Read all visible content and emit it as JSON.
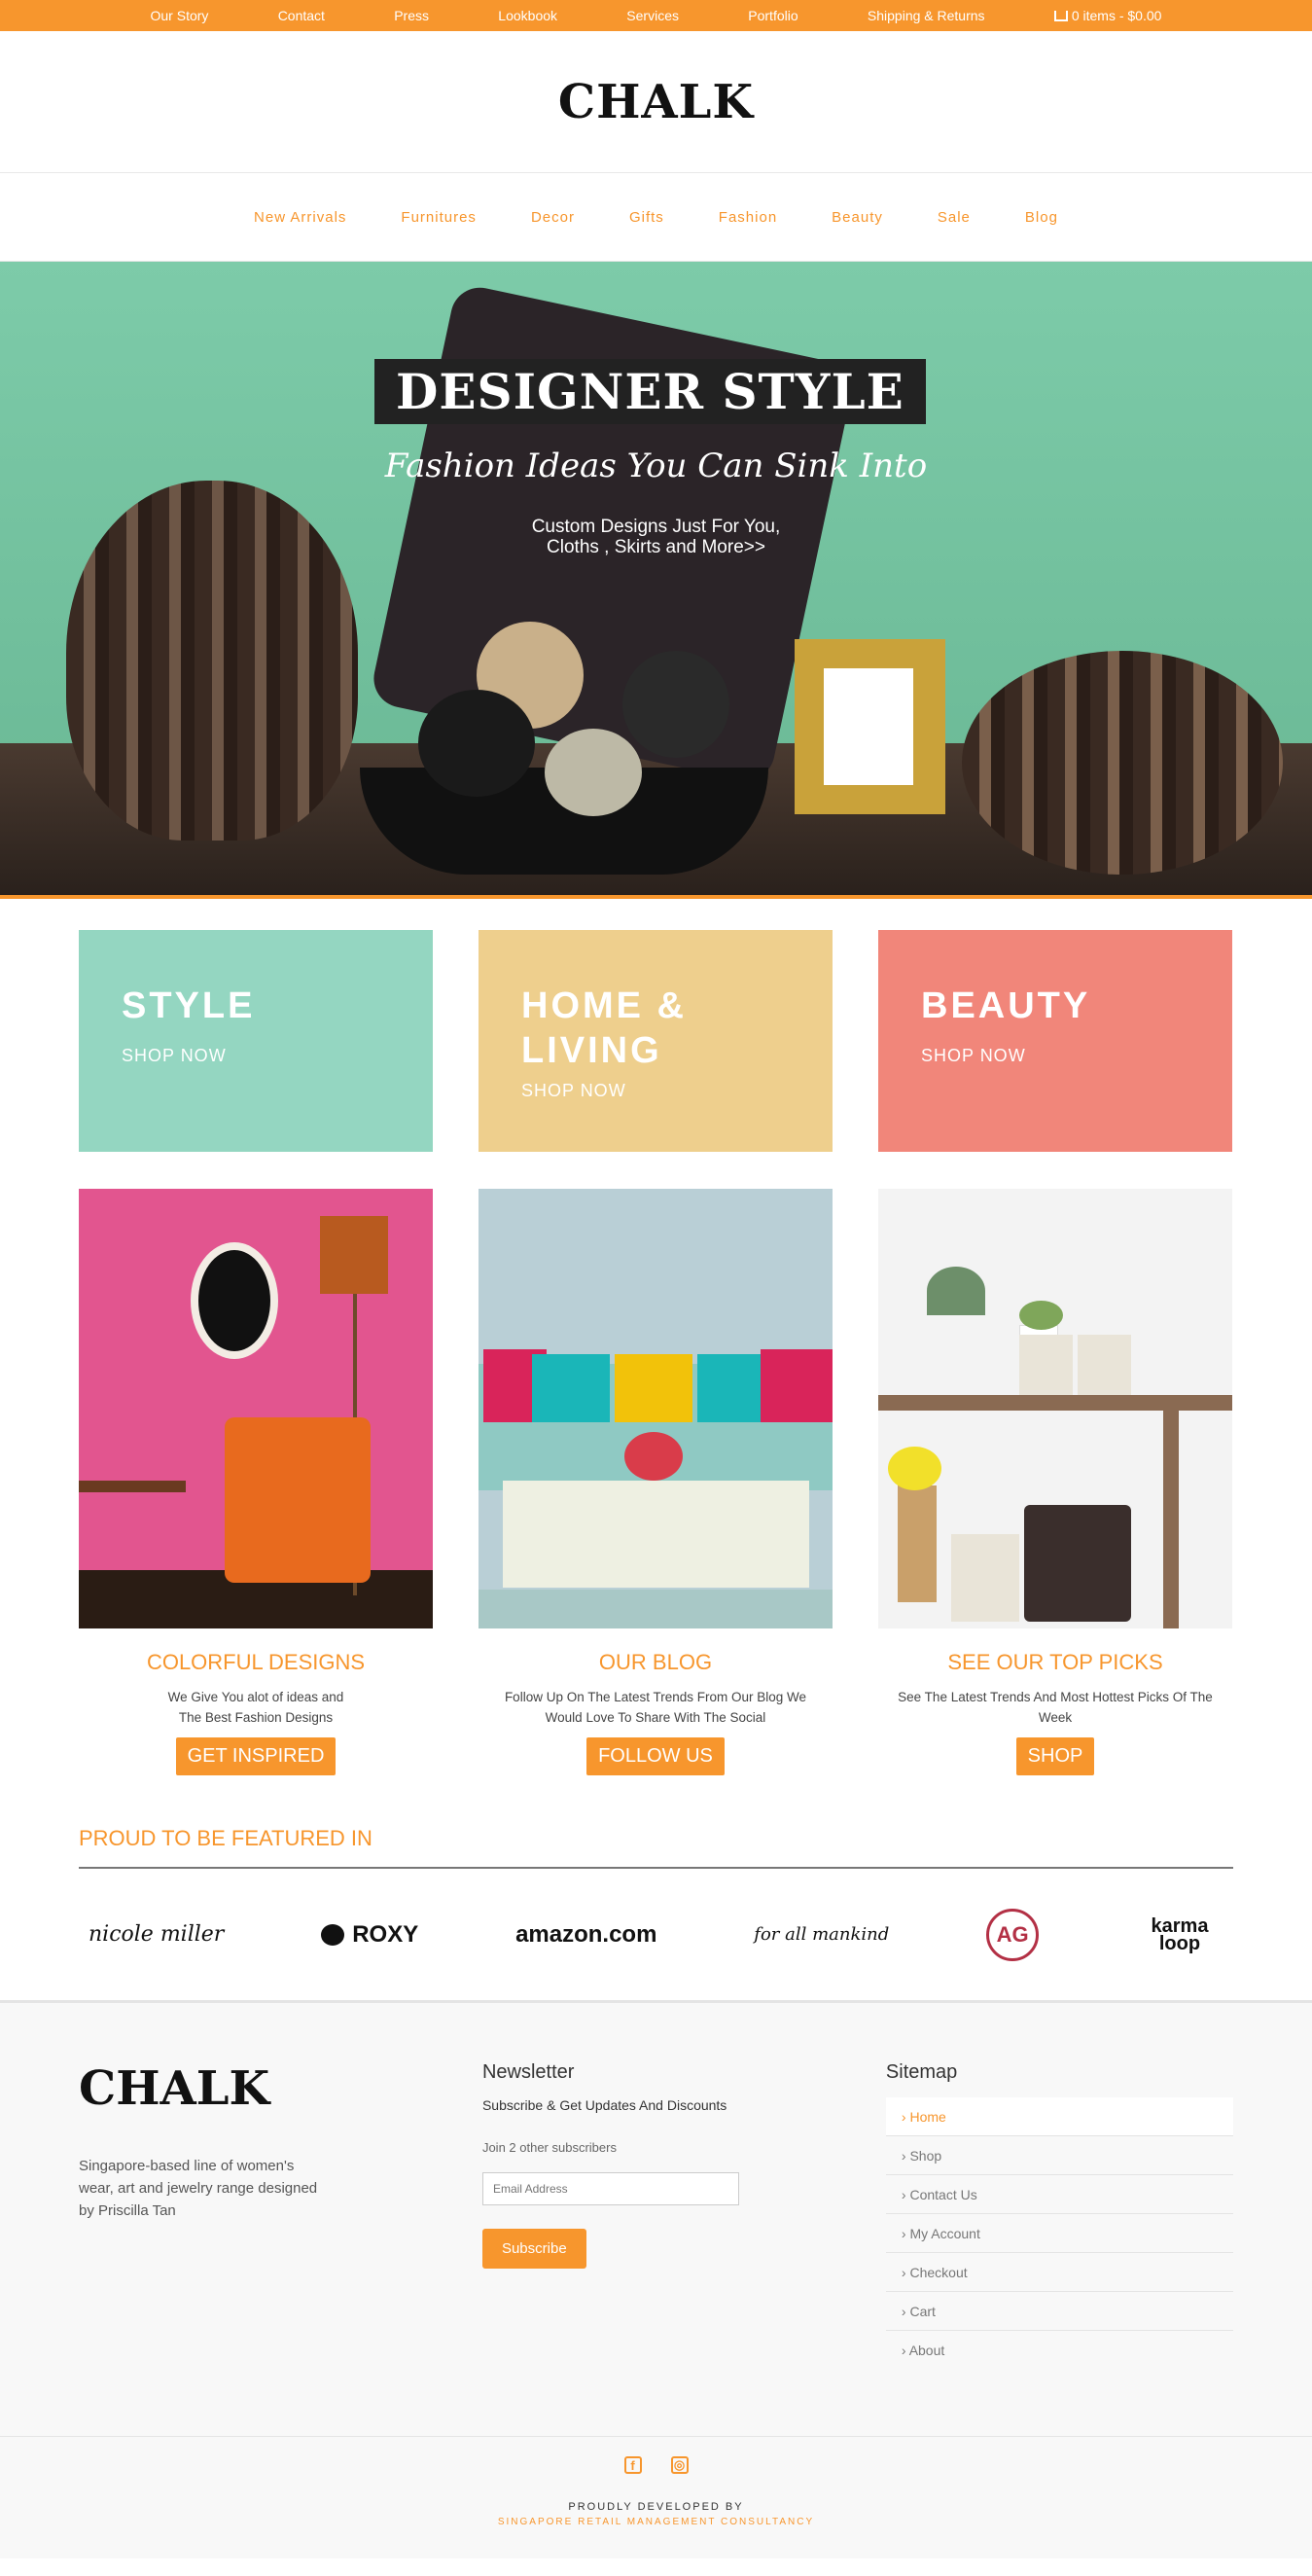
{
  "topbar": {
    "links": [
      "Our Story",
      "Contact",
      "Press",
      "Lookbook",
      "Services",
      "Portfolio",
      "Shipping & Returns"
    ],
    "cart": "0 items - $0.00"
  },
  "header": {
    "logo": "CHALK"
  },
  "nav": [
    "New Arrivals",
    "Furnitures",
    "Decor",
    "Gifts",
    "Fashion",
    "Beauty",
    "Sale",
    "Blog"
  ],
  "hero": {
    "title": "DESIGNER STYLE",
    "subtitle": "Fashion Ideas You Can Sink  Into",
    "description": "Custom Designs Just For You,\nCloths , Skirts and More>>"
  },
  "tiles": [
    {
      "title": "STYLE",
      "cta": "SHOP NOW",
      "color": "#94d6c1"
    },
    {
      "title": "HOME & LIVING",
      "cta": "SHOP NOW",
      "color": "#eecf8d"
    },
    {
      "title": "BEAUTY",
      "cta": "SHOP NOW",
      "color": "#f1867a"
    }
  ],
  "cards": [
    {
      "title": "COLORFUL DESIGNS",
      "text": "We Give You alot of ideas and The Best Fashion Designs",
      "button": "GET INSPIRED"
    },
    {
      "title": "OUR BLOG",
      "text": "Follow Up On The Latest Trends From Our Blog We Would Love To Share With The Social",
      "button": "FOLLOW US"
    },
    {
      "title": "SEE OUR TOP PICKS",
      "text": "See The Latest Trends And Most Hottest Picks Of The Week",
      "button": "SHOP"
    }
  ],
  "featured": {
    "heading": "PROUD TO BE FEATURED IN",
    "brands": [
      "nicole miller",
      "ROXY",
      "amazon.com",
      "for all mankind",
      "AG",
      "karma loop"
    ]
  },
  "footer": {
    "logo": "CHALK",
    "description": "Singapore-based line of women's wear, art and jewelry range designed by Priscilla Tan",
    "newsletter": {
      "heading": "Newsletter",
      "subheading": "Subscribe & Get Updates And Discounts",
      "join": "Join 2 other subscribers",
      "placeholder": "Email Address",
      "button": "Subscribe"
    },
    "sitemap": {
      "heading": "Sitemap",
      "links": [
        "Home",
        "Shop",
        "Contact Us",
        "My Account",
        "Checkout",
        "Cart",
        "About"
      ]
    }
  },
  "bottom": {
    "line1": "PROUDLY DEVELOPED BY",
    "line2": "SINGAPORE RETAIL MANAGEMENT CONSULTANCY",
    "icons": [
      "facebook-icon",
      "instagram-icon"
    ]
  },
  "colors": {
    "accent": "#f7962d"
  }
}
